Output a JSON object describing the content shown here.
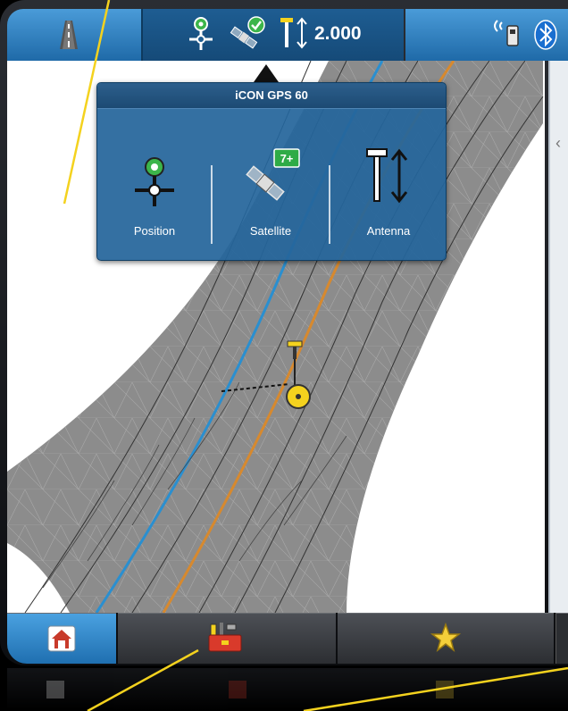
{
  "status_bar": {
    "antenna_height": "2.000",
    "satellite_count_badge": "7+",
    "icons": [
      "road-view-icon",
      "position-pin-icon",
      "satellite-ok-icon",
      "antenna-height-icon",
      "radio-icon",
      "bluetooth-icon"
    ]
  },
  "popup": {
    "title": "iCON GPS 60",
    "items": [
      {
        "label": "Position",
        "icon": "position-pin-icon"
      },
      {
        "label": "Satellite",
        "icon": "satellite-icon"
      },
      {
        "label": "Antenna",
        "icon": "antenna-height-icon"
      }
    ]
  },
  "tabs": [
    {
      "name": "home",
      "icon": "home-icon"
    },
    {
      "name": "tools",
      "icon": "toolbox-icon"
    },
    {
      "name": "favorites",
      "icon": "star-icon"
    }
  ],
  "colors": {
    "accent_blue": "#2a7fc4",
    "road_gray": "#8c8c8c",
    "design_line_orange": "#d7892e",
    "design_line_blue": "#2a8fd0",
    "annotation_yellow": "#f4d21e"
  }
}
